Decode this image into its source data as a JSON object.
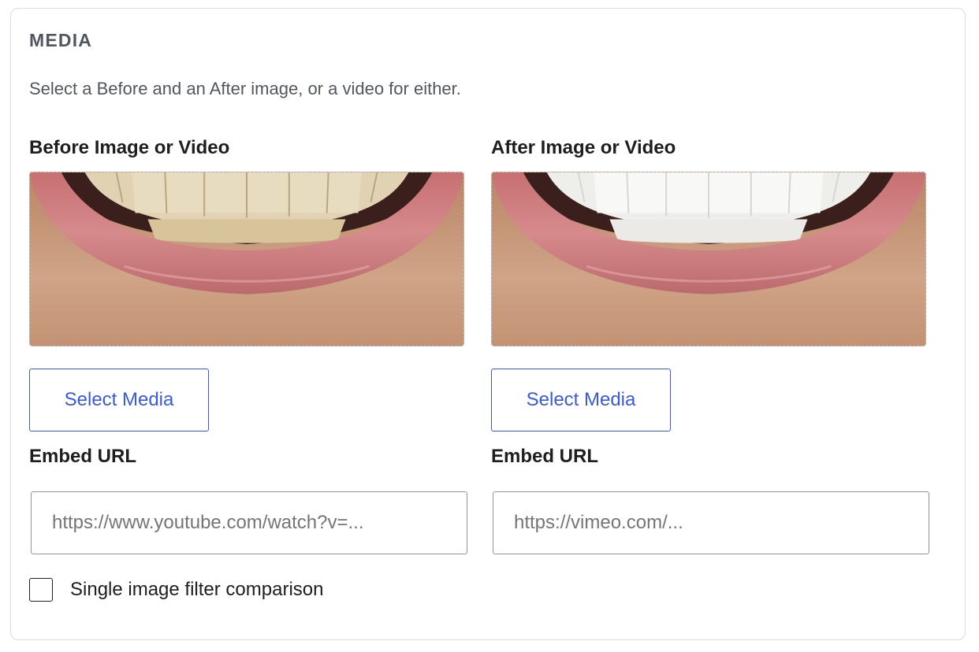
{
  "panel": {
    "title": "MEDIA",
    "description": "Select a Before and an After image, or a video for either."
  },
  "before": {
    "label": "Before Image or Video",
    "preview_alt": "Smile with yellowed teeth",
    "teeth_color": "#e8dcc0",
    "select_button": "Select Media",
    "embed_label": "Embed URL",
    "embed_value": "",
    "embed_placeholder": "https://www.youtube.com/watch?v=..."
  },
  "after": {
    "label": "After Image or Video",
    "preview_alt": "Smile with whitened teeth",
    "teeth_color": "#f8f8f6",
    "select_button": "Select Media",
    "embed_label": "Embed URL",
    "embed_value": "",
    "embed_placeholder": "https://vimeo.com/..."
  },
  "single_filter": {
    "label": "Single image filter comparison",
    "checked": false
  },
  "colors": {
    "accent": "#3858e9",
    "text": "#1e1e1e",
    "muted": "#50575e",
    "border": "#dcdcde"
  }
}
